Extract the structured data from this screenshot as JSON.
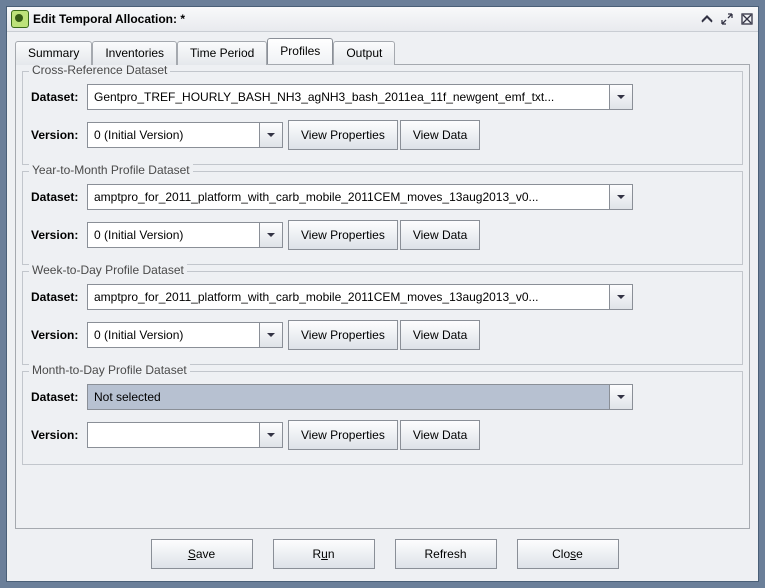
{
  "window": {
    "title": "Edit Temporal Allocation: *"
  },
  "tabs": {
    "summary": "Summary",
    "inventories": "Inventories",
    "time_period": "Time Period",
    "profiles": "Profiles",
    "output": "Output"
  },
  "groups": {
    "xref": {
      "title": "Cross-Reference Dataset",
      "dataset_label": "Dataset:",
      "dataset_value": "Gentpro_TREF_HOURLY_BASH_NH3_agNH3_bash_2011ea_11f_newgent_emf_txt...",
      "version_label": "Version:",
      "version_value": "0 (Initial Version)",
      "view_properties": "View Properties",
      "view_data": "View Data"
    },
    "y2m": {
      "title": "Year-to-Month Profile Dataset",
      "dataset_label": "Dataset:",
      "dataset_value": "amptpro_for_2011_platform_with_carb_mobile_2011CEM_moves_13aug2013_v0...",
      "version_label": "Version:",
      "version_value": "0 (Initial Version)",
      "view_properties": "View Properties",
      "view_data": "View Data"
    },
    "w2d": {
      "title": "Week-to-Day Profile Dataset",
      "dataset_label": "Dataset:",
      "dataset_value": "amptpro_for_2011_platform_with_carb_mobile_2011CEM_moves_13aug2013_v0...",
      "version_label": "Version:",
      "version_value": "0 (Initial Version)",
      "view_properties": "View Properties",
      "view_data": "View Data"
    },
    "m2d": {
      "title": "Month-to-Day Profile Dataset",
      "dataset_label": "Dataset:",
      "dataset_value": "Not selected",
      "version_label": "Version:",
      "version_value": "",
      "view_properties": "View Properties",
      "view_data": "View Data"
    }
  },
  "buttons": {
    "save": "Save",
    "run": "Run",
    "refresh": "Refresh",
    "close": "Close"
  }
}
